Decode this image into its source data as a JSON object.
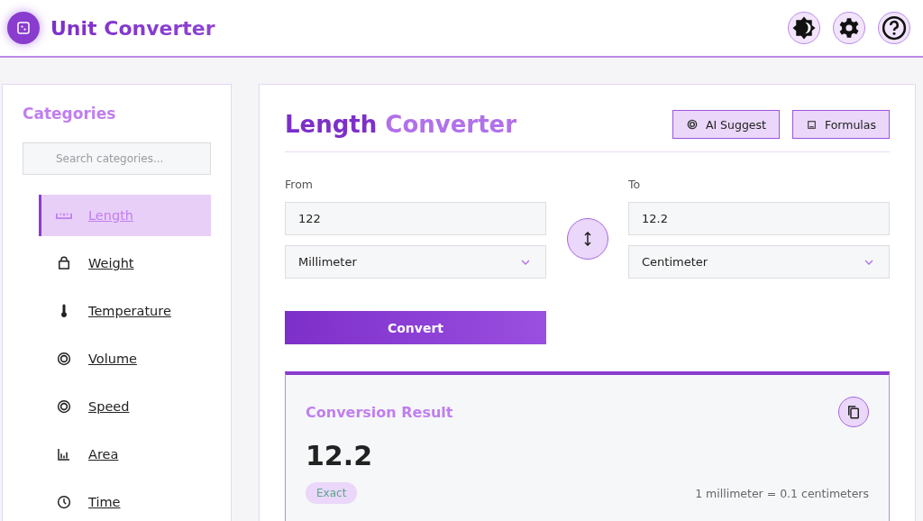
{
  "app": {
    "title": "Unit Converter"
  },
  "sidebar": {
    "title": "Categories",
    "search": {
      "placeholder": "Search categories..."
    },
    "items": [
      {
        "label": "Length",
        "selected": true
      },
      {
        "label": "Weight",
        "selected": false
      },
      {
        "label": "Temperature",
        "selected": false
      },
      {
        "label": "Volume",
        "selected": false
      },
      {
        "label": "Speed",
        "selected": false
      },
      {
        "label": "Area",
        "selected": false
      },
      {
        "label": "Time",
        "selected": false
      }
    ]
  },
  "converter": {
    "title_part1": "Length",
    "title_part2": "Converter",
    "actions": [
      "AI Suggest",
      "Formulas"
    ],
    "from": {
      "label": "From",
      "value": "122",
      "unit": "Millimeter"
    },
    "to": {
      "label": "To",
      "value": "12.2",
      "unit": "Centimeter"
    },
    "convert_button": "Convert",
    "result": {
      "title": "Conversion Result",
      "value": "12.2",
      "badge": "Exact",
      "formula": "1 millimeter = 0.1 centimeters"
    }
  }
}
